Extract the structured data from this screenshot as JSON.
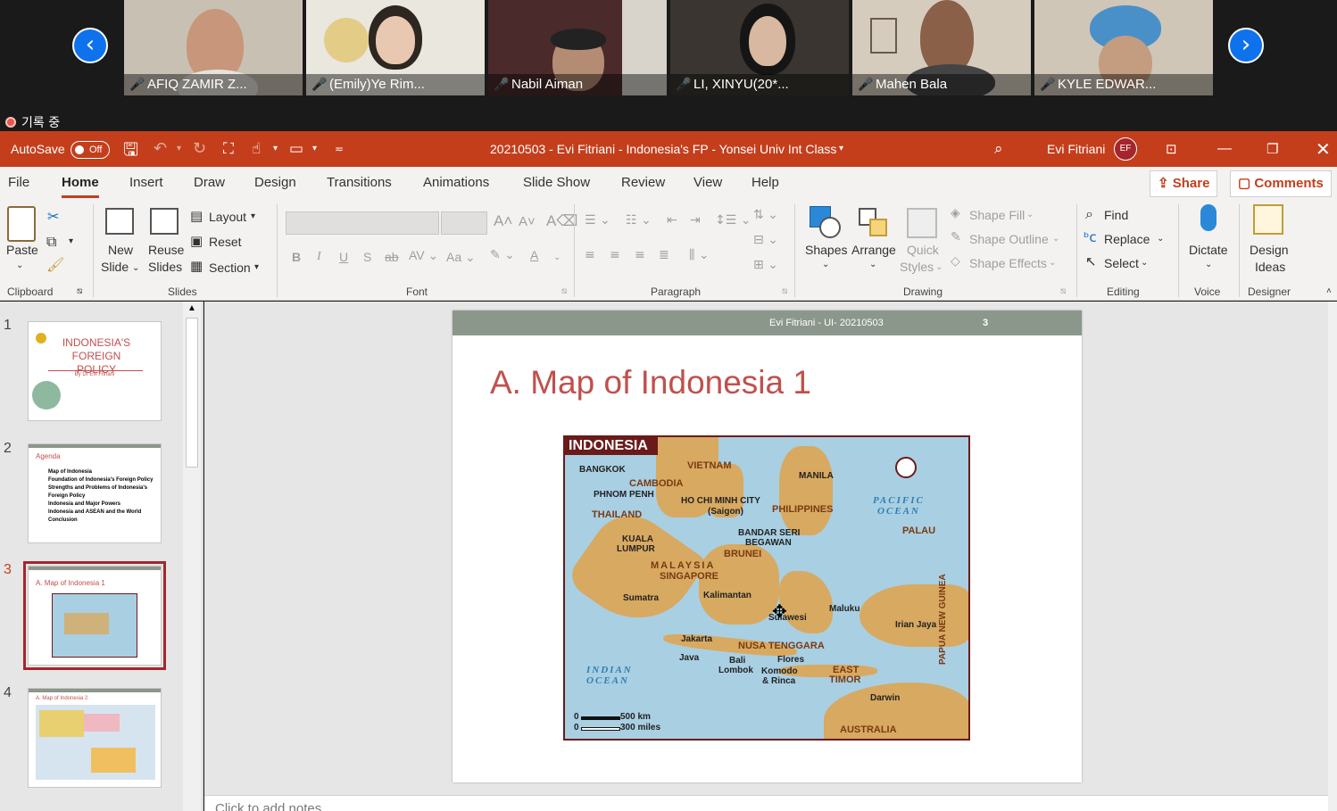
{
  "zoom": {
    "participants": [
      {
        "name": "AFIQ ZAMIR Z..."
      },
      {
        "name": "(Emily)Ye Rim..."
      },
      {
        "name": "Nabil Aiman"
      },
      {
        "name": "LI, XINYU(20*..."
      },
      {
        "name": "Mahen Bala"
      },
      {
        "name": "KYLE EDWAR..."
      }
    ],
    "recording_label": "기록 중",
    "prev_icon": "chevron-left-icon",
    "next_icon": "chevron-right-icon"
  },
  "titlebar": {
    "autosave_label": "AutoSave",
    "autosave_state": "Off",
    "doc_title": "20210503 - Evi Fitriani - Indonesia's FP - Yonsei Univ Int Class",
    "user_name": "Evi Fitriani",
    "user_initials": "EF",
    "accent_color": "#c43e1c"
  },
  "tabs": [
    "File",
    "Home",
    "Insert",
    "Draw",
    "Design",
    "Transitions",
    "Animations",
    "Slide Show",
    "Review",
    "View",
    "Help"
  ],
  "active_tab": "Home",
  "share_label": "Share",
  "comments_label": "Comments",
  "ribbon": {
    "clipboard": {
      "paste": "Paste",
      "group": "Clipboard"
    },
    "slides": {
      "new_slide_1": "New",
      "new_slide_2": "Slide",
      "reuse_1": "Reuse",
      "reuse_2": "Slides",
      "layout": "Layout",
      "reset": "Reset",
      "section": "Section",
      "group": "Slides"
    },
    "font": {
      "group": "Font",
      "bold": "B",
      "italic": "I",
      "underline": "U",
      "shadow": "S",
      "strike": "ab",
      "font_color": "A"
    },
    "paragraph": {
      "group": "Paragraph"
    },
    "drawing": {
      "shapes": "Shapes",
      "arrange": "Arrange",
      "quick_1": "Quick",
      "quick_2": "Styles",
      "shape_fill": "Shape Fill",
      "shape_outline": "Shape Outline",
      "shape_effects": "Shape Effects",
      "group": "Drawing"
    },
    "editing": {
      "find": "Find",
      "replace": "Replace",
      "select": "Select",
      "group": "Editing"
    },
    "voice": {
      "dictate": "Dictate",
      "group": "Voice"
    },
    "designer": {
      "ideas_1": "Design",
      "ideas_2": "Ideas",
      "group": "Designer"
    }
  },
  "thumbnails": [
    {
      "num": "1",
      "title": "INDONESIA'S FOREIGN POLICY",
      "sub": "By Dr Evi Fitriani"
    },
    {
      "num": "2",
      "title": "Agenda",
      "items": [
        "Map of Indonesia",
        "Foundation of Indonesia's Foreign Policy",
        "Strengths and Problems of Indonesia's Foreign Policy",
        "Indonesia and Major Powers",
        "Indonesia and ASEAN and the World",
        "Conclusion"
      ]
    },
    {
      "num": "3",
      "title": "A. Map of Indonesia 1"
    },
    {
      "num": "4",
      "title": "A. Map of Indonesia 2"
    }
  ],
  "slide": {
    "header_text": "Evi Fitriani - UI- 20210503",
    "page_number": "3",
    "title": "A. Map of  Indonesia 1",
    "map": {
      "banner": "INDONESIA",
      "labels": {
        "bangkok": "BANGKOK",
        "vietnam": "VIETNAM",
        "manila": "MANILA",
        "cambodia": "CAMBODIA",
        "phnom_penh": "PHNOM PENH",
        "hcm": "HO CHI MINH CITY",
        "saigon": "(Saigon)",
        "philippines": "PHILIPPINES",
        "pacific_1": "PACIFIC",
        "pacific_2": "OCEAN",
        "thailand": "THAILAND",
        "palau": "PALAU",
        "kuala_1": "KUALA",
        "kuala_2": "LUMPUR",
        "bandar_1": "BANDAR SERI",
        "bandar_2": "BEGAWAN",
        "brunei": "BRUNEI",
        "malaysia": "MALAYSIA",
        "singapore": "SINGAPORE",
        "sumatra": "Sumatra",
        "kalimantan": "Kalimantan",
        "maluku": "Maluku",
        "sulawesi": "Sulawesi",
        "irian": "Irian Jaya",
        "papua": "PAPUA NEW GUINEA",
        "jakarta": "Jakarta",
        "nusa": "NUSA TENGGARA",
        "java": "Java",
        "bali": "Bali",
        "lombok": "Lombok",
        "flores": "Flores",
        "komodo_1": "Komodo",
        "komodo_2": "& Rinca",
        "east_1": "EAST",
        "east_2": "TIMOR",
        "indian_1": "INDIAN",
        "indian_2": "OCEAN",
        "darwin": "Darwin",
        "australia": "AUSTRALIA",
        "scale_km": "500 km",
        "scale_mi": "300 miles",
        "zero": "0"
      }
    }
  },
  "notes_placeholder": "Click to add notes"
}
